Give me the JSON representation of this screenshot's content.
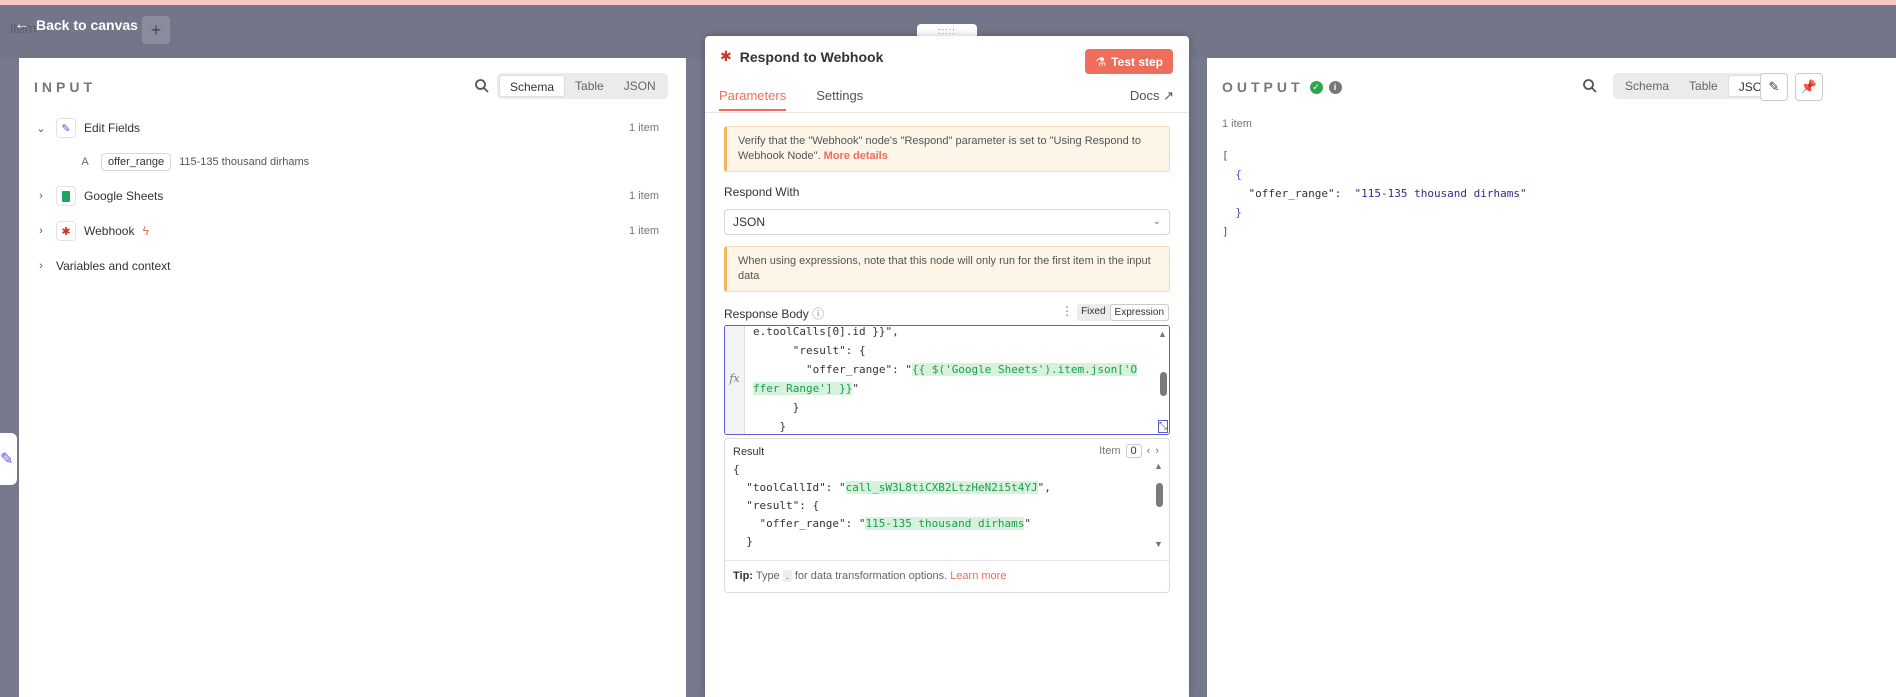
{
  "canvas": {
    "back_label": "Back to canvas",
    "ghost_label": "ltem",
    "add_icon": "+",
    "handle": ":::::"
  },
  "input": {
    "title": "INPUT",
    "modes": [
      "Schema",
      "Table",
      "JSON"
    ],
    "active_mode": "Schema",
    "nodes": [
      {
        "name": "Edit Fields",
        "count": "1 item",
        "expanded": true
      },
      {
        "name": "Google Sheets",
        "count": "1 item",
        "expanded": false
      },
      {
        "name": "Webhook",
        "count": "1 item",
        "expanded": false
      }
    ],
    "field": {
      "type": "A",
      "key": "offer_range",
      "value": "115-135 thousand dirhams"
    },
    "variables_label": "Variables and context"
  },
  "node": {
    "title": "Respond to Webhook",
    "test_label": "Test step",
    "tabs": [
      "Parameters",
      "Settings"
    ],
    "active_tab": "Parameters",
    "docs_label": "Docs",
    "notice1_text": "Verify that the \"Webhook\" node's \"Respond\" parameter is set to \"Using Respond to Webhook Node\".",
    "notice1_link": "More details",
    "respond_with_label": "Respond With",
    "respond_with_value": "JSON",
    "notice2_text": "When using expressions, note that this node will only run for the first item in the input data",
    "body_label": "Response Body",
    "fixed_label": "Fixed",
    "expression_label": "Expression",
    "fx": "fx",
    "code": {
      "line1": "e.toolCalls[0].id }}\",",
      "line2": "      \"result\": {",
      "line3a": "        \"offer_range\": \"",
      "line3b": "{{ $('Google Sheets').item.json['O",
      "line4a": "ffer Range'] }}",
      "line4b": "\"",
      "line5": "      }",
      "line6": "    }"
    },
    "result": {
      "label": "Result",
      "item_label": "Item",
      "item_index": "0",
      "line1": "{",
      "line2a": "  \"toolCallId\": \"",
      "line2b": "call_sW3L8tiCXB2LtzHeN2i5t4YJ",
      "line2c": "\",",
      "line3": "  \"result\": {",
      "line4a": "    \"offer_range\": \"",
      "line4b": "115-135 thousand dirhams",
      "line4c": "\"",
      "line5": "  }"
    },
    "tip_label": "Tip:",
    "tip_pre": "Type",
    "tip_dot": ".",
    "tip_post": "for data transformation options.",
    "tip_link": "Learn more"
  },
  "output": {
    "title": "OUTPUT",
    "modes": [
      "Schema",
      "Table",
      "JSON"
    ],
    "active_mode": "JSON",
    "count": "1 item",
    "json": {
      "open": "[",
      "obj_open": "{",
      "key": "\"offer_range\":",
      "value": "\"115-135 thousand dirhams\"",
      "obj_close": "}",
      "close": "]"
    }
  }
}
